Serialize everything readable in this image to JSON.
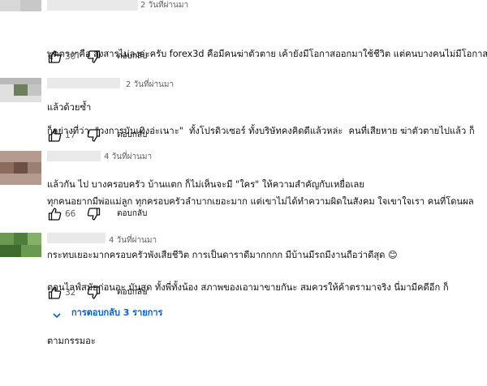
{
  "comments": [
    {
      "time": "2 วันที่ผ่านมา",
      "lines": [
        "พูดตรงๆคือ สงสารไม่ลงอ่ะครับ forex3d คือมีคนฆ่าตัวตาย เค้ายังมีโอกาสออกมาใช้ชีวิต แต่คนบางคนไม่มีโอกาส",
        "แล้วด้วยซ้ำ"
      ],
      "likes": "30",
      "reply_label": "ตอบกลับ",
      "avatar_colors": [
        "#d8d8d8",
        "#c8c8c8",
        "#e2e2e2",
        "#bdbdbd"
      ]
    },
    {
      "time": "2 วันที่ผ่านมา",
      "lines": [
        "ก็อย่างที่ว่า  \"วงการบันเทิงอ่ะเนาะ\"  ทั้งโปรดิวเซอร์ ทั้งบริษัทคงคิดดีแล้วหล่ะ  คนที่เสียหาย ฆ่าตัวตายไปแล้ว ก็",
        "แล้วกัน ไป บางครอบครัว บ้านแตก ก็ไม่เห็นจะมี \"ใคร\" ให้ความสำคัญกับเหยื่อเลย"
      ],
      "likes": "17",
      "reply_label": "ตอบกลับ",
      "avatar_colors": [
        "#b9b9b9",
        "#6e7f5e",
        "#e0e0e0",
        "#c4c4c4"
      ]
    },
    {
      "time": "4 วันที่ผ่านมา",
      "lines": [
        "ทุกคนอยากมีพ่อแม่ลูก ทุกครอบครัวลำบากเยอะมาก แต่เขาไม่ได้ทำความผิดในสังคม ใจเขาใจเรา คนที่โดนผล",
        "กระทบเยอะมากครอบครัวพังเสียชีวิต การเป็นดาราดีมากกกก มีบ้านมีรถมีงานถือว่าดีสุด 😊"
      ],
      "likes": "66",
      "reply_label": "ตอบกลับ",
      "avatar_colors": [
        "#8a6b5c",
        "#6c4f45",
        "#b49a8f",
        "#9a7f74"
      ]
    },
    {
      "time": "4 วันที่ผ่านมา",
      "lines": [
        "ตอนไลฟ์สมัยก่อนอะ มันสุด ทั้งพี่ทั้งน้อง สภาพของเอามาขายกันะ สมควรให้ค้าตรามาจริง นี่มามีคดีอีก ก็",
        "ตามกรรมอะ"
      ],
      "likes": "32",
      "reply_label": "ตอบกลับ",
      "avatar_colors": [
        "#4e7d3c",
        "#6a9a52",
        "#3f6a30",
        "#85b06a"
      ]
    }
  ],
  "replies_link": {
    "label": "การตอบกลับ 3 รายการ",
    "color": "#065fd4"
  },
  "icons": {
    "like": "thumbs-up-icon",
    "dislike": "thumbs-down-icon",
    "expand": "chevron-down-icon"
  }
}
